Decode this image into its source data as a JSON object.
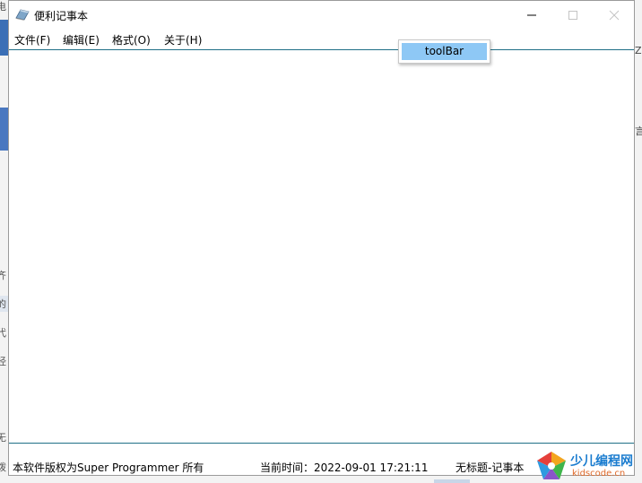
{
  "window": {
    "title": "便利记事本",
    "icon": "notepad-icon",
    "controls": {
      "minimize_icon": "minimize-icon",
      "maximize_icon": "maximize-icon",
      "close_icon": "close-icon"
    }
  },
  "menu": {
    "items": [
      {
        "label": "文件(F)"
      },
      {
        "label": "编辑(E)"
      },
      {
        "label": "格式(O)"
      },
      {
        "label": "关于(H)"
      }
    ]
  },
  "toolbar_popup": {
    "item_label": "toolBar",
    "highlight_color": "#8ec8f5"
  },
  "editor": {
    "content": ""
  },
  "status": {
    "copyright": "本软件版权为Super Programmer 所有",
    "time": "当前时间：2022-09-01 17:21:11",
    "document": "无标题-记事本"
  },
  "watermark": {
    "title": "少儿编程网",
    "domain": "kidscode.cn"
  },
  "background": {
    "left_fragments": [
      "电",
      "齐",
      "的",
      "代",
      "经",
      "无",
      "拨"
    ],
    "right_fragments": [
      "Z",
      "言"
    ]
  },
  "colors": {
    "editor_border": "#1f6f87",
    "background_accent": "#3b6fb6"
  }
}
